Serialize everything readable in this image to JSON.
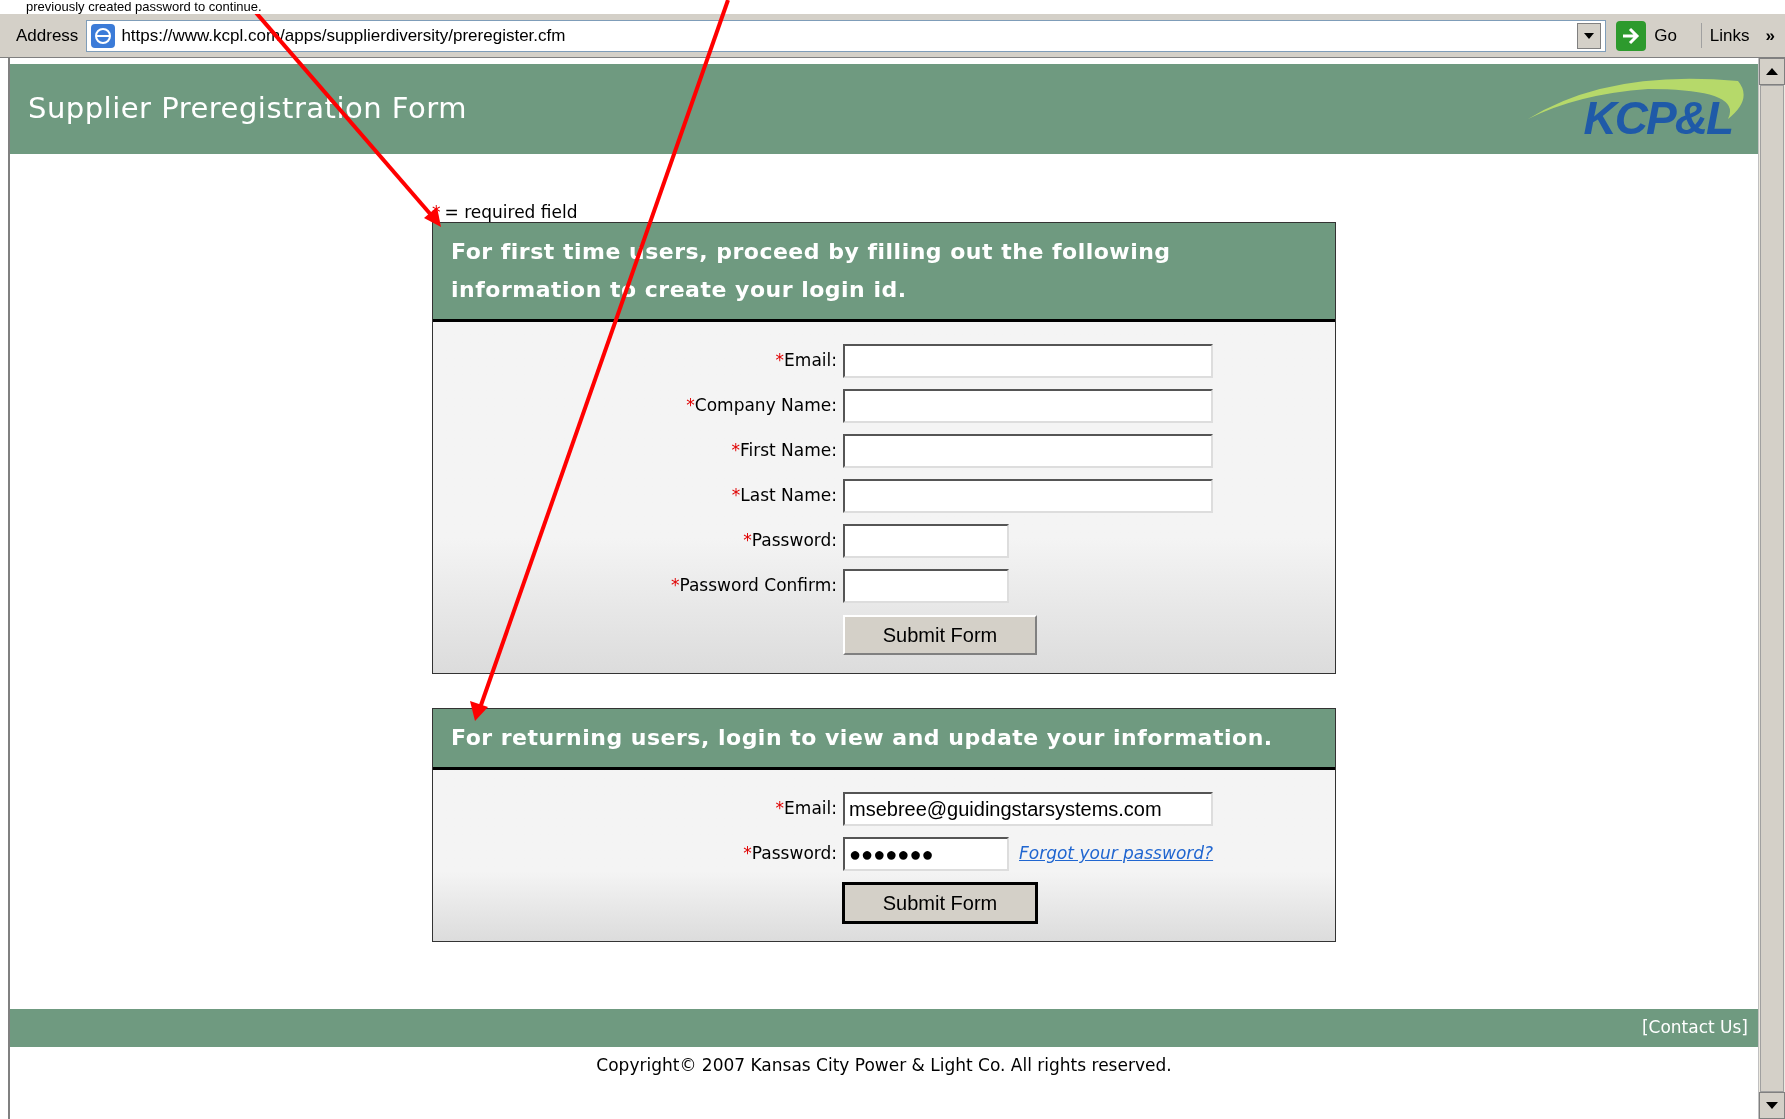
{
  "annotation": {
    "text": "previously created password to continue."
  },
  "browser": {
    "address_label": "Address",
    "url": "https://www.kcpl.com/apps/supplierdiversity/preregister.cfm",
    "go_label": "Go",
    "links_label": "Links",
    "more": "»"
  },
  "header": {
    "title": "Supplier Preregistration Form",
    "logo": "KCP&L"
  },
  "required_note": {
    "mark": "*",
    "text": "= required field"
  },
  "sections": [
    {
      "heading": "For first time users, proceed by filling out the following information to create your login id.",
      "fields": [
        {
          "mark": "*",
          "label": "Email:",
          "kind": "long"
        },
        {
          "mark": "*",
          "label": "Company Name:",
          "kind": "long"
        },
        {
          "mark": "*",
          "label": "First Name:",
          "kind": "long"
        },
        {
          "mark": "*",
          "label": "Last Name:",
          "kind": "long"
        },
        {
          "mark": "*",
          "label": "Password:",
          "kind": "short"
        },
        {
          "mark": "*",
          "label": "Password Confirm:",
          "kind": "short"
        }
      ],
      "button": "Submit Form",
      "focused": false
    },
    {
      "heading": "For returning users, login to view and update your information.",
      "fields": [
        {
          "mark": "*",
          "label": "Email:",
          "kind": "long",
          "value": "msebree@guidingstarsystems.com"
        },
        {
          "mark": "*",
          "label": "Password:",
          "kind": "short",
          "value": "●●●●●●●",
          "link": "Forgot your password?"
        }
      ],
      "button": "Submit Form",
      "focused": true
    }
  ],
  "footer": {
    "link": "[Contact Us]",
    "copyright": "Copyright© 2007 Kansas City Power & Light Co. All rights reserved."
  }
}
